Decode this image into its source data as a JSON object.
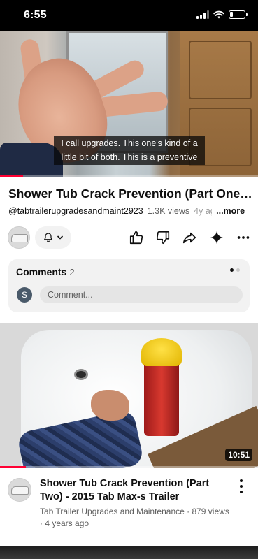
{
  "status_bar": {
    "time": "6:55"
  },
  "player": {
    "caption_line1": "I call upgrades. This one's kind of a",
    "caption_line2": "little bit of both. This is a preventive",
    "progress_fraction": 0.09
  },
  "video": {
    "title": "Shower Tub Crack Prevention (Part One)...",
    "channel_handle": "@tabtrailerupgradesandmaint2923",
    "views": "1.3K views",
    "ago": "4y ago",
    "more_label": "...more"
  },
  "actions": {
    "like_icon": "thumbs-up-icon",
    "dislike_icon": "thumbs-down-icon",
    "share_icon": "share-icon",
    "ask_icon": "sparkle-icon",
    "more_icon": "more-horizontal-icon"
  },
  "comments": {
    "title": "Comments",
    "count": "2",
    "user_initial": "S",
    "placeholder": "Comment..."
  },
  "next_video": {
    "duration": "10:51",
    "watched_fraction": 0.1,
    "title": "Shower Tub Crack Prevention (Part Two) - 2015 Tab Max-s Trailer",
    "meta_line1": "Tab Trailer Upgrades and Maintenance · 879 views",
    "meta_line2": "· 4 years ago"
  },
  "colors": {
    "accent": "#ff0033",
    "text": "#0f0f0f",
    "secondary": "#606060"
  }
}
